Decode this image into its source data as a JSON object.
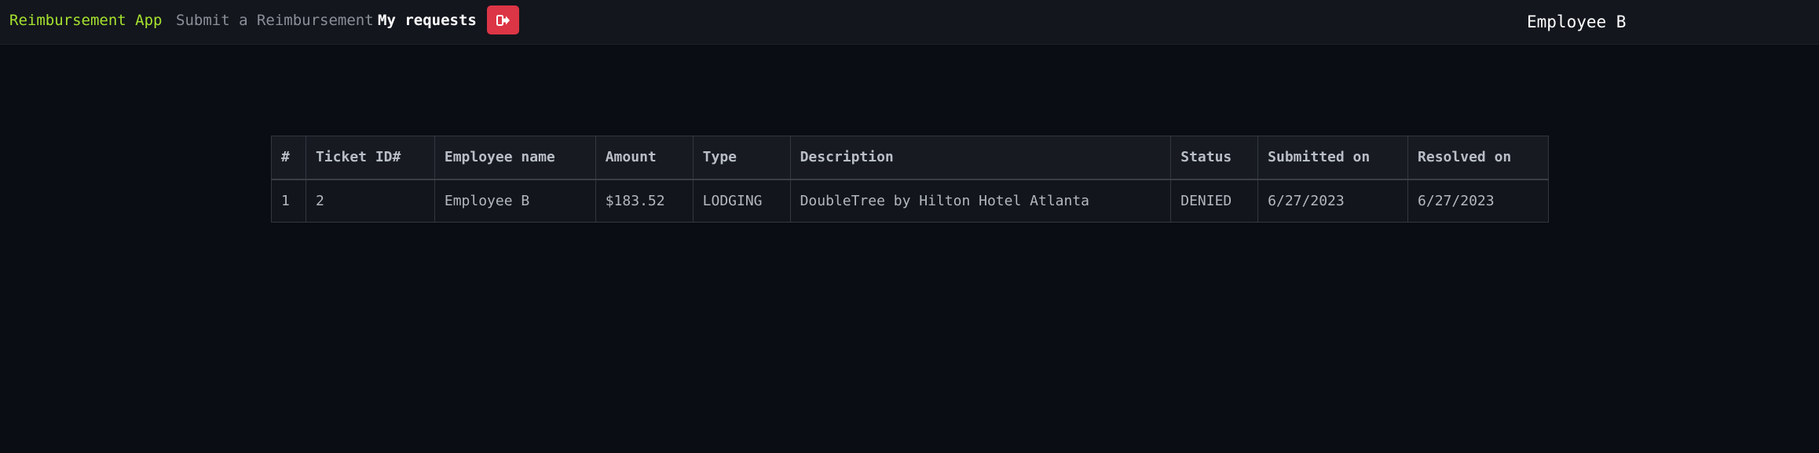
{
  "navbar": {
    "brand": "Reimbursement App",
    "submit_link": "Submit a Reimbursement",
    "requests_link": "My requests",
    "logout_icon": "sign-out-icon",
    "user_name": "Employee B"
  },
  "colors": {
    "background": "#0a0d14",
    "navbar": "#13161d",
    "brand": "#a6e22e",
    "logout_button": "#dc3545"
  },
  "table": {
    "headers": [
      "#",
      "Ticket ID#",
      "Employee name",
      "Amount",
      "Type",
      "Description",
      "Status",
      "Submitted on",
      "Resolved on"
    ],
    "rows": [
      [
        "1",
        "2",
        "Employee B",
        "$183.52",
        "LODGING",
        "DoubleTree by Hilton Hotel Atlanta",
        "DENIED",
        "6/27/2023",
        "6/27/2023"
      ]
    ]
  }
}
